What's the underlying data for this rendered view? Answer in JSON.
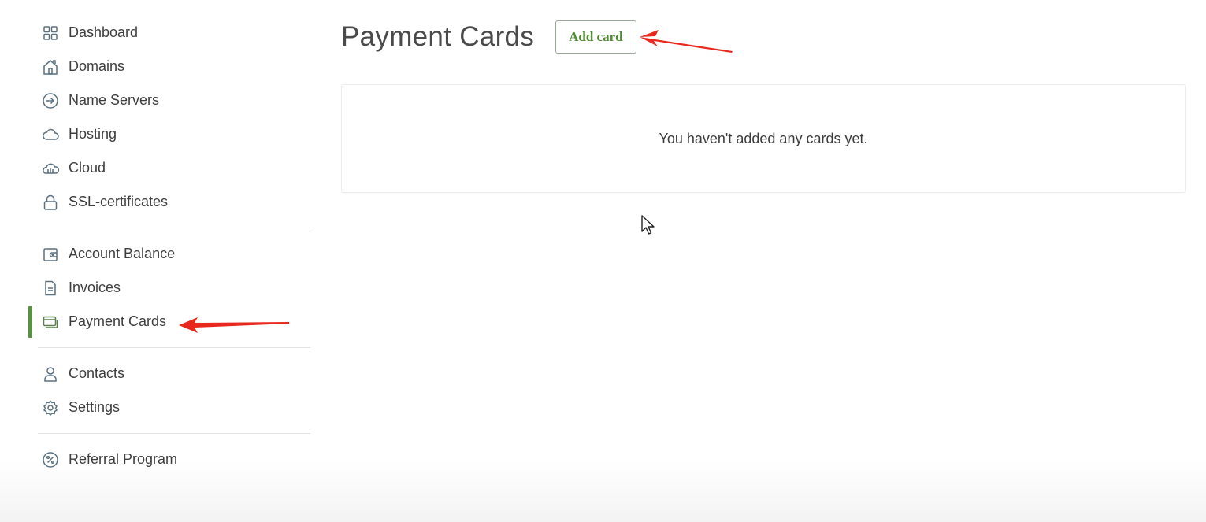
{
  "sidebar": {
    "groups": [
      [
        {
          "label": "Dashboard",
          "icon": "grid-icon"
        },
        {
          "label": "Domains",
          "icon": "house-icon"
        },
        {
          "label": "Name Servers",
          "icon": "arrow-circle-icon"
        },
        {
          "label": "Hosting",
          "icon": "cloud-icon"
        },
        {
          "label": "Cloud",
          "icon": "cloud-server-icon"
        },
        {
          "label": "SSL-certificates",
          "icon": "lock-icon"
        }
      ],
      [
        {
          "label": "Account Balance",
          "icon": "wallet-icon"
        },
        {
          "label": "Invoices",
          "icon": "document-icon"
        },
        {
          "label": "Payment Cards",
          "icon": "cards-icon",
          "active": true
        }
      ],
      [
        {
          "label": "Contacts",
          "icon": "user-icon"
        },
        {
          "label": "Settings",
          "icon": "gear-icon"
        }
      ],
      [
        {
          "label": "Referral Program",
          "icon": "percent-icon"
        }
      ]
    ]
  },
  "main": {
    "title": "Payment Cards",
    "add_button_label": "Add card",
    "empty_message": "You haven't added any cards yet."
  },
  "colors": {
    "accent_green": "#5b8f46",
    "annotation_red": "#e8281d",
    "icon_slate": "#5a7080"
  }
}
